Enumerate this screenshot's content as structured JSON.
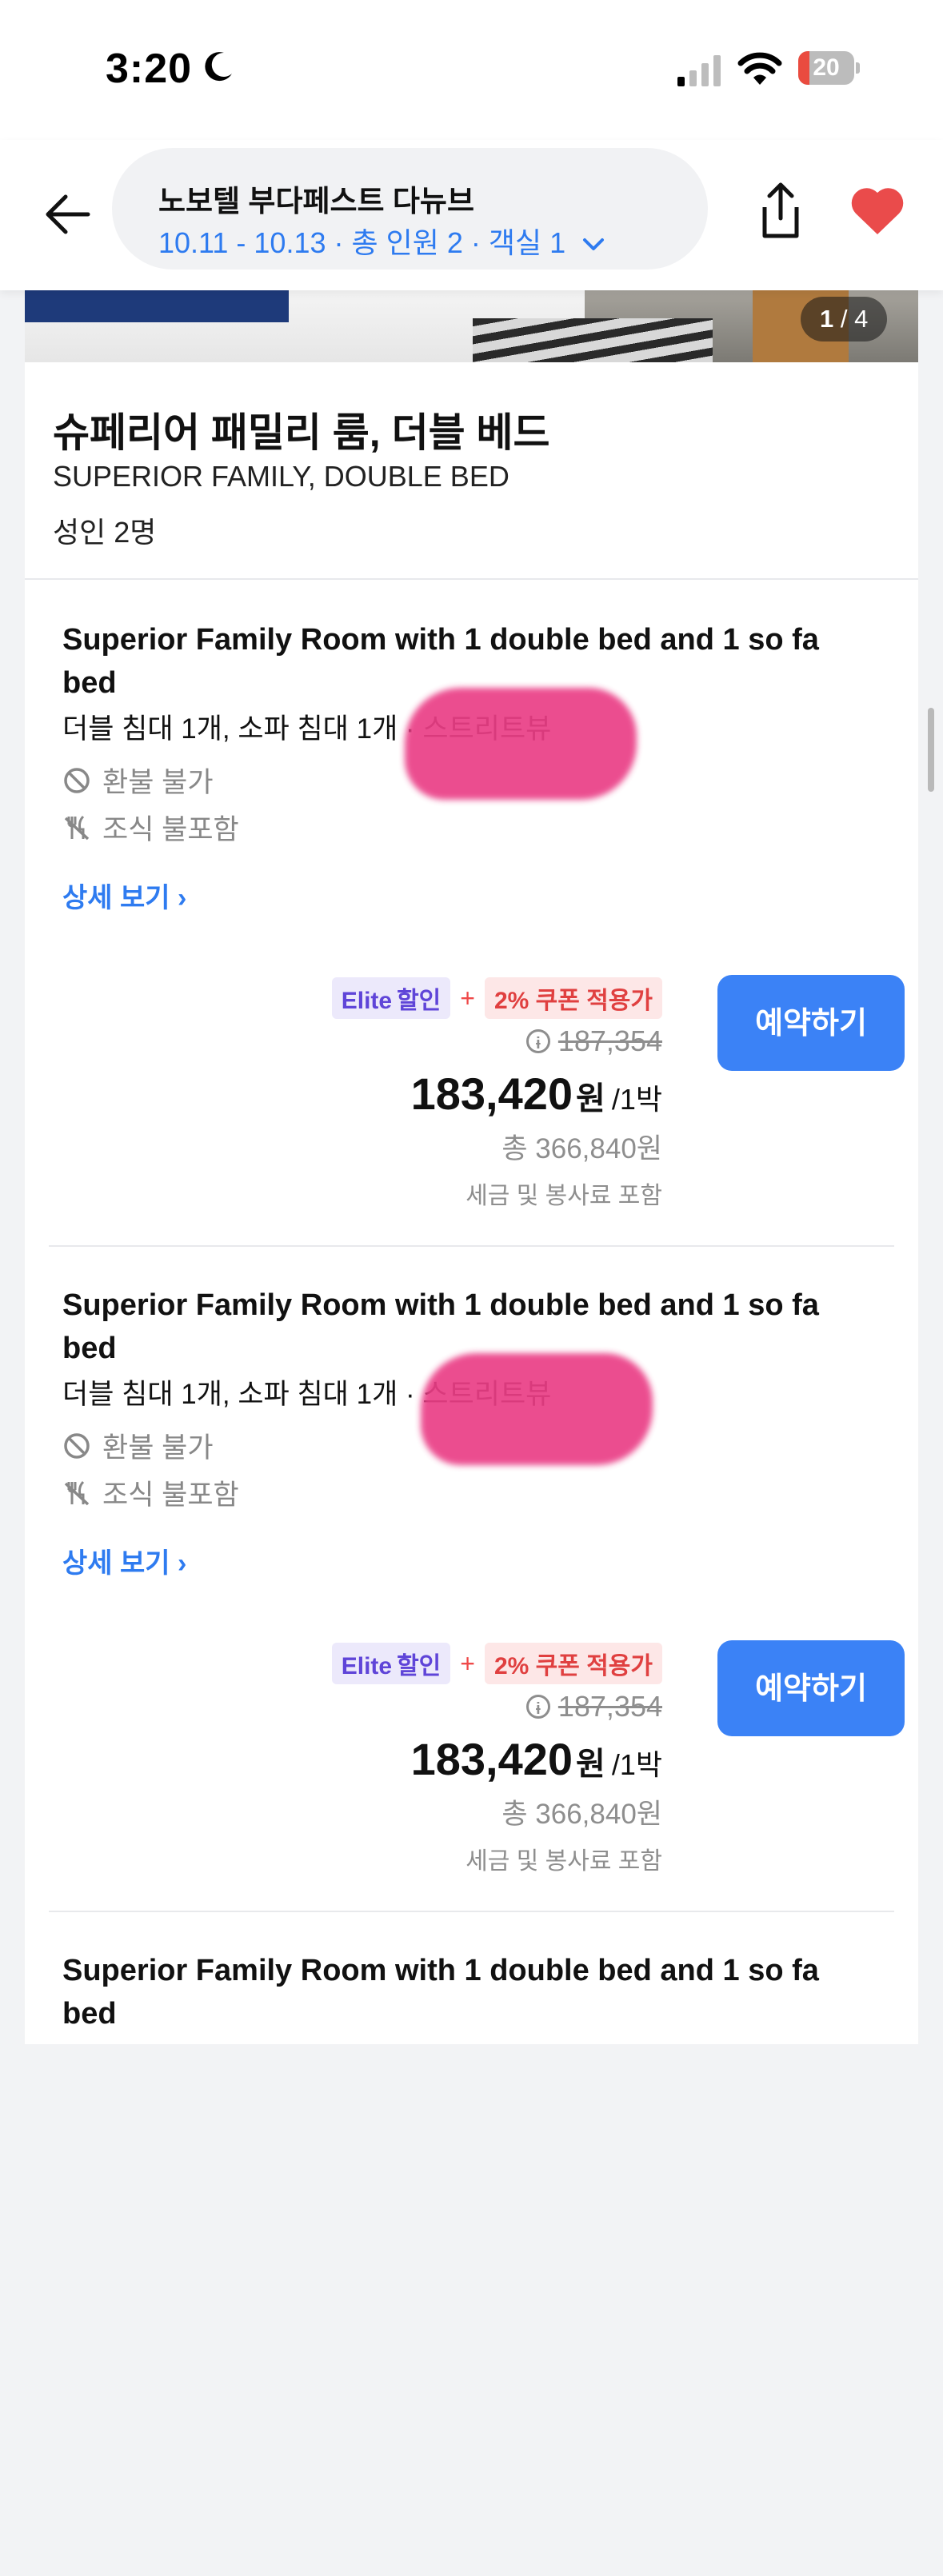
{
  "status_bar": {
    "time": "3:20",
    "battery": "20",
    "battery_level": 0.2,
    "icons": [
      "moon-icon",
      "cellular-signal-icon",
      "wifi-icon",
      "battery-icon"
    ]
  },
  "header": {
    "hotel_name": "노보텔 부다페스트 다뉴브",
    "search_summary": "10.11 - 10.13 · 총 인원 2 · 객실 1",
    "icons": [
      "back-arrow-icon",
      "chevron-down-icon",
      "share-icon",
      "heart-icon"
    ],
    "heart_color": "#ea4b4b",
    "accent_color": "#2e7bf0"
  },
  "gallery": {
    "current": "1",
    "separator": "/",
    "total": "4"
  },
  "room": {
    "title_ko": "슈페리어 패밀리 룸, 더블 베드",
    "title_en": "SUPERIOR FAMILY, DOUBLE BED",
    "occupancy": "성인 2명"
  },
  "offers": [
    {
      "title": "Superior Family Room with 1 double bed and 1 so fa bed",
      "beds_view": "더블 침대 1개, 소파 침대 1개 · 스트리트뷰",
      "refund": "환불 불가",
      "meal": "조식 불포함",
      "detail_link": "상세 보기 ›",
      "badge_elite": "Elite",
      "badge_elite_sub": "할인",
      "plus": "+",
      "badge_coupon": "2% 쿠폰 적용가",
      "original_price": "187,354",
      "price": "183,420",
      "currency": "원",
      "per_night": "/1박",
      "total": "총 366,840원",
      "tax_note": "세금 및 봉사료 포함",
      "book_label": "예약하기"
    },
    {
      "title": "Superior Family Room with 1 double bed and 1 so fa bed",
      "beds_view": "더블 침대 1개, 소파 침대 1개 · 스트리트뷰",
      "refund": "환불 불가",
      "meal": "조식 불포함",
      "detail_link": "상세 보기 ›",
      "badge_elite": "Elite",
      "badge_elite_sub": "할인",
      "plus": "+",
      "badge_coupon": "2% 쿠폰 적용가",
      "original_price": "187,354",
      "price": "183,420",
      "currency": "원",
      "per_night": "/1박",
      "total": "총 366,840원",
      "tax_note": "세금 및 봉사료 포함",
      "book_label": "예약하기"
    },
    {
      "title": "Superior Family Room with 1 double bed and 1 so fa bed"
    }
  ],
  "colors": {
    "book_button": "#3b82f6",
    "elite_badge": "#5f45d8",
    "coupon_badge": "#e04040",
    "redaction": "#ea3e86"
  }
}
